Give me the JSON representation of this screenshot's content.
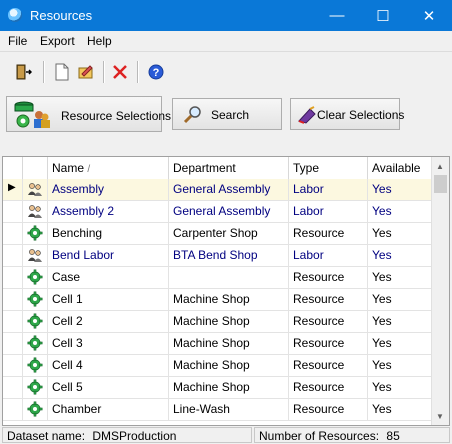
{
  "window": {
    "title": "Resources",
    "minimize": "—",
    "maximize": "☐",
    "close": "✕"
  },
  "menu": [
    "File",
    "Export",
    "Help"
  ],
  "buttons": {
    "resource_selections": "Resource Selections",
    "search": "Search",
    "clear_selections": "Clear Selections"
  },
  "table": {
    "columns": [
      "Name",
      "Department",
      "Type",
      "Available"
    ],
    "sort_indicator": "/",
    "rows": [
      {
        "icon": "people-icon",
        "name": "Assembly",
        "department": "General Assembly",
        "type": "Labor",
        "available": "Yes",
        "selected": true
      },
      {
        "icon": "people-icon",
        "name": "Assembly 2",
        "department": "General Assembly",
        "type": "Labor",
        "available": "Yes"
      },
      {
        "icon": "gear-icon",
        "name": "Benching",
        "department": "Carpenter Shop",
        "type": "Resource",
        "available": "Yes"
      },
      {
        "icon": "people-icon",
        "name": "Bend Labor",
        "department": "BTA Bend Shop",
        "type": "Labor",
        "available": "Yes"
      },
      {
        "icon": "gear-icon",
        "name": "Case",
        "department": "",
        "type": "Resource",
        "available": "Yes"
      },
      {
        "icon": "gear-icon",
        "name": "Cell 1",
        "department": "Machine Shop",
        "type": "Resource",
        "available": "Yes"
      },
      {
        "icon": "gear-icon",
        "name": "Cell 2",
        "department": "Machine Shop",
        "type": "Resource",
        "available": "Yes"
      },
      {
        "icon": "gear-icon",
        "name": "Cell 3",
        "department": "Machine Shop",
        "type": "Resource",
        "available": "Yes"
      },
      {
        "icon": "gear-icon",
        "name": "Cell 4",
        "department": "Machine Shop",
        "type": "Resource",
        "available": "Yes"
      },
      {
        "icon": "gear-icon",
        "name": "Cell 5",
        "department": "Machine Shop",
        "type": "Resource",
        "available": "Yes"
      },
      {
        "icon": "gear-icon",
        "name": "Chamber",
        "department": "Line-Wash",
        "type": "Resource",
        "available": "Yes"
      }
    ]
  },
  "status": {
    "dataset_label": "Dataset name:",
    "dataset_value": "DMSProduction",
    "count_label": "Number of Resources:",
    "count_value": "85"
  },
  "colors": {
    "titlebar": "#0a78d7",
    "labor_text": "#000080",
    "selected_row": "#fcf8e0"
  }
}
